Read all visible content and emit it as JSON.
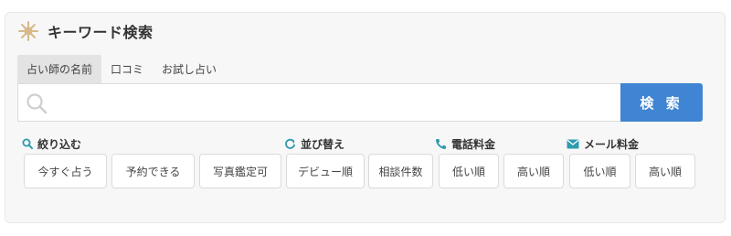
{
  "header": {
    "title": "キーワード検索",
    "icon": "sun-icon",
    "icon_color": "#d8b98a"
  },
  "tabs": [
    {
      "label": "占い師の名前",
      "active": true
    },
    {
      "label": "口コミ",
      "active": false
    },
    {
      "label": "お試し占い",
      "active": false
    }
  ],
  "search": {
    "value": "",
    "placeholder": "",
    "button_label": "検 索",
    "button_color": "#3f85d3"
  },
  "filters": {
    "narrow": {
      "label": "絞り込む",
      "icon": "search-icon",
      "options": [
        "今すぐ占う",
        "予約できる",
        "写真鑑定可"
      ]
    },
    "sort": {
      "label": "並び替え",
      "icon": "refresh-icon",
      "options": [
        "デビュー順",
        "相談件数"
      ]
    },
    "phone_rate": {
      "label": "電話料金",
      "icon": "phone-icon",
      "options": [
        "低い順",
        "高い順"
      ]
    },
    "mail_rate": {
      "label": "メール料金",
      "icon": "mail-icon",
      "options": [
        "低い順",
        "高い順"
      ]
    }
  },
  "accent_color": "#2e9bb0"
}
